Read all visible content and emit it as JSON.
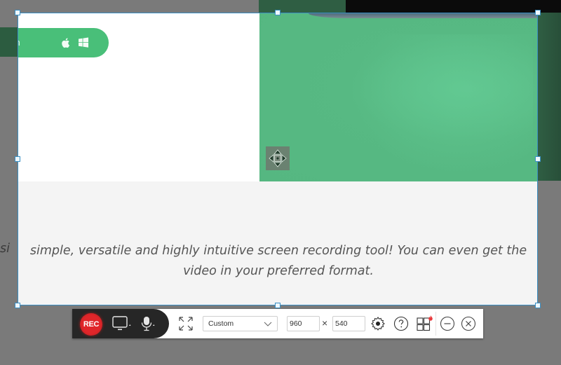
{
  "page": {
    "download_pill": {
      "text_visible": "o version",
      "icons": [
        "apple-icon",
        "windows-icon"
      ],
      "color": "#49bf79"
    },
    "tagline": {
      "line1": "simple, versatile and highly intuitive screen recording tool! You can even get the",
      "line2": "video in your preferred format.",
      "line1_outside": "si"
    },
    "hero_color": "#55b781"
  },
  "selection": {
    "border_color": "#3a8fc4",
    "move_handle": "move-icon"
  },
  "toolbar": {
    "rec_label": "REC",
    "rec_color": "#e0262a",
    "screen_source_icon": "monitor-icon",
    "audio_source_icon": "microphone-icon",
    "fullscreen_icon": "expand-icon",
    "region_preset": {
      "selected": "Custom"
    },
    "width_value": "960",
    "height_value": "540",
    "dimension_separator": "×",
    "settings_icon": "gear-icon",
    "help_icon": "help-icon",
    "apps_icon": "grid-icon",
    "minimize_icon": "minimize-icon",
    "close_icon": "close-icon"
  }
}
